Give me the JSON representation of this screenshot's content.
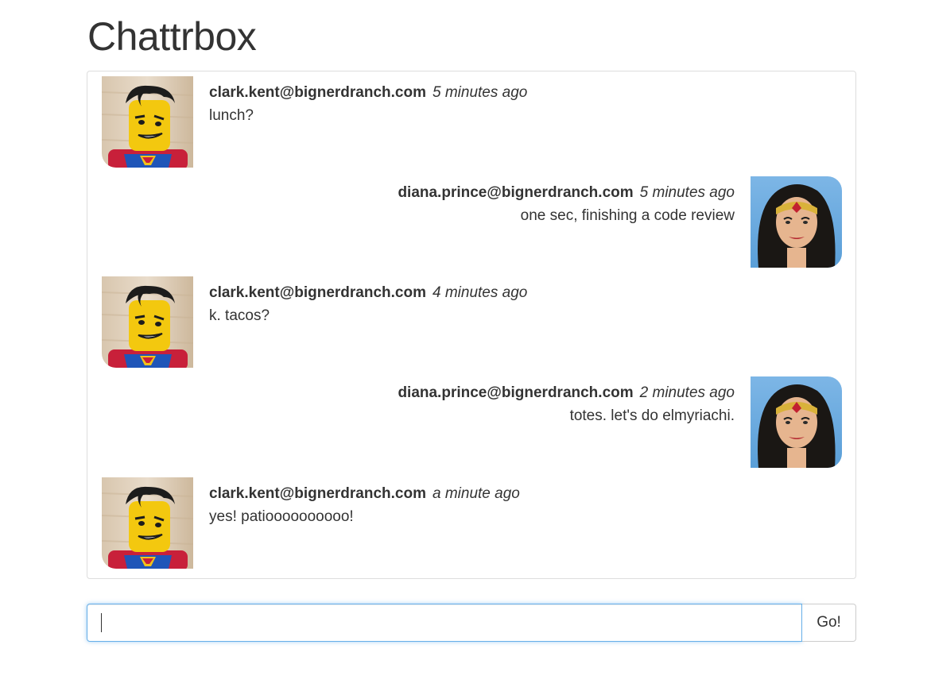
{
  "app": {
    "title": "Chattrbox"
  },
  "messages": [
    {
      "author": "clark.kent@bignerdranch.com",
      "time": "5 minutes ago",
      "text": "lunch?",
      "side": "left",
      "avatar": "superman-lego-avatar"
    },
    {
      "author": "diana.prince@bignerdranch.com",
      "time": "5 minutes ago",
      "text": "one sec, finishing a code review",
      "side": "right",
      "avatar": "wonder-woman-avatar"
    },
    {
      "author": "clark.kent@bignerdranch.com",
      "time": "4 minutes ago",
      "text": "k. tacos?",
      "side": "left",
      "avatar": "superman-lego-avatar"
    },
    {
      "author": "diana.prince@bignerdranch.com",
      "time": "2 minutes ago",
      "text": "totes. let's do elmyriachi.",
      "side": "right",
      "avatar": "wonder-woman-avatar"
    },
    {
      "author": "clark.kent@bignerdranch.com",
      "time": "a minute ago",
      "text": "yes! patioooooooooo!",
      "side": "left",
      "avatar": "superman-lego-avatar"
    }
  ],
  "composer": {
    "input_value": "",
    "button_label": "Go!"
  },
  "colors": {
    "focus_border": "#66afe9",
    "panel_border": "#dddddd",
    "text": "#333333"
  }
}
